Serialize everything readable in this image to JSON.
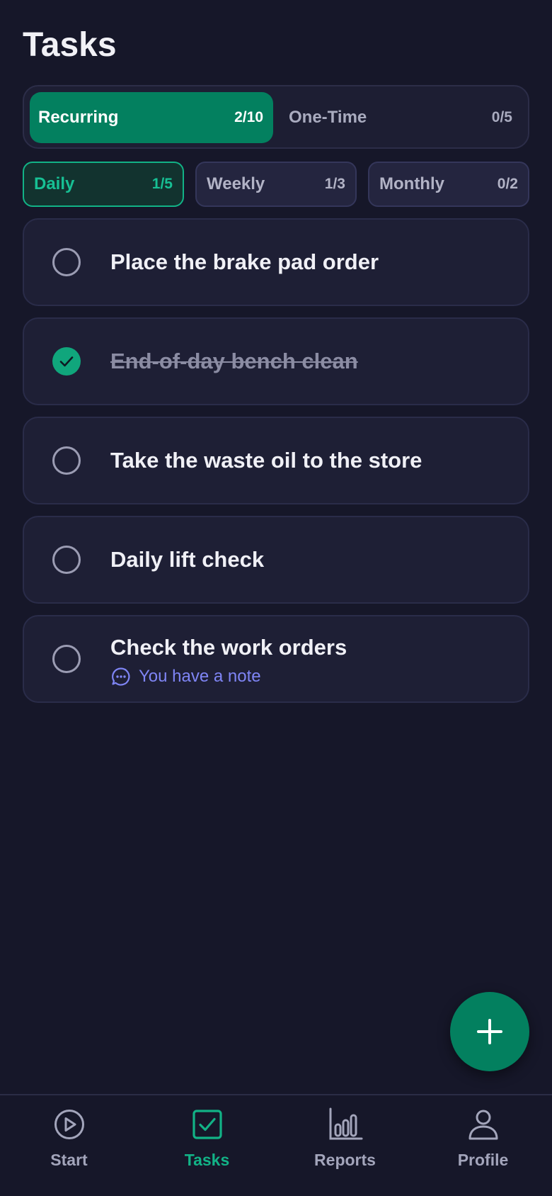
{
  "header": {
    "title": "Tasks"
  },
  "segments": [
    {
      "label": "Recurring",
      "count": "2/10",
      "active": true
    },
    {
      "label": "One-Time",
      "count": "0/5",
      "active": false
    }
  ],
  "filters": [
    {
      "label": "Daily",
      "count": "1/5",
      "active": true
    },
    {
      "label": "Weekly",
      "count": "1/3",
      "active": false
    },
    {
      "label": "Monthly",
      "count": "0/2",
      "active": false
    }
  ],
  "tasks": [
    {
      "title": "Place the brake pad order",
      "done": false
    },
    {
      "title": "End-of-day bench clean",
      "done": true
    },
    {
      "title": "Take the waste oil to the store",
      "done": false
    },
    {
      "title": "Daily lift check",
      "done": false
    },
    {
      "title": "Check the work orders",
      "done": false,
      "note": "You have a note"
    }
  ],
  "fab": {
    "icon": "plus-icon"
  },
  "nav": [
    {
      "label": "Start",
      "icon": "play-icon",
      "active": false
    },
    {
      "label": "Tasks",
      "icon": "checkbox-icon",
      "active": true
    },
    {
      "label": "Reports",
      "icon": "bar-chart-icon",
      "active": false
    },
    {
      "label": "Profile",
      "icon": "user-icon",
      "active": false
    }
  ],
  "colors": {
    "background": "#161729",
    "accent": "#03805f",
    "accent_light": "#12b286",
    "note": "#7f85f5"
  }
}
